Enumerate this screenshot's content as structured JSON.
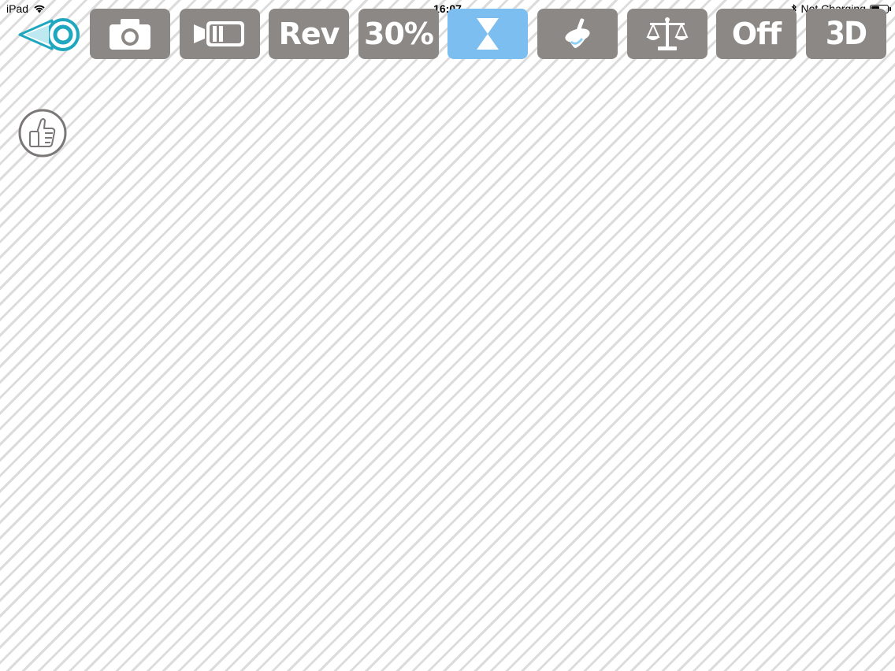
{
  "status_bar": {
    "device": "iPad",
    "time": "16:07",
    "charging": "Not Charging",
    "battery_level": 0.55
  },
  "toolbar": {
    "back_icon": "back-arrow-icon",
    "buttons": [
      {
        "id": "camera",
        "icon": "camera-icon"
      },
      {
        "id": "video",
        "icon": "video-camera-icon"
      },
      {
        "id": "rev",
        "label": "Rev"
      },
      {
        "id": "percent",
        "label": "30%"
      },
      {
        "id": "timer",
        "icon": "hourglass-icon",
        "active": true
      },
      {
        "id": "spin",
        "icon": "spinning-top-icon"
      },
      {
        "id": "balance",
        "icon": "balance-scale-icon"
      },
      {
        "id": "off",
        "label": "Off"
      },
      {
        "id": "threed",
        "label": "3D"
      }
    ]
  },
  "colors": {
    "button_gray": "#8c8886",
    "button_active": "#7dbef0",
    "back_accent": "#2bb3c8",
    "stripe": "#dcdcdc"
  },
  "side": {
    "thumb_icon": "thumbs-up-icon"
  }
}
